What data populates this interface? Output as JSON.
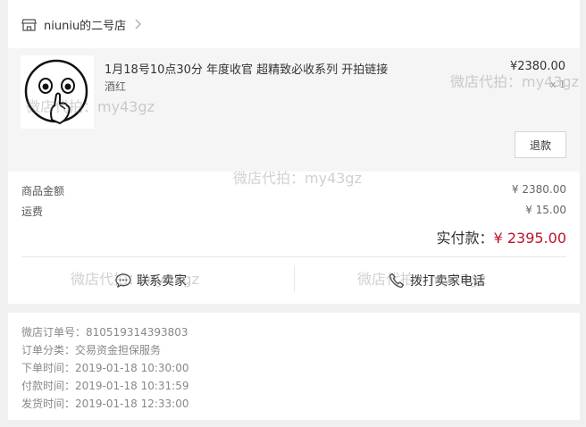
{
  "shop": {
    "name": "niuniu的二号店"
  },
  "product": {
    "title": "1月18号10点30分 年度收官 超精致必收系列 开拍链接",
    "variant": "酒红",
    "price": "¥2380.00",
    "quantity": "x 1",
    "refund_label": "退款"
  },
  "amounts": {
    "goods_label": "商品金额",
    "goods_value": "¥ 2380.00",
    "shipping_label": "运费",
    "shipping_value": "¥ 15.00",
    "total_label": "实付款：",
    "total_value": "¥ 2395.00"
  },
  "actions": {
    "contact_label": "联系卖家",
    "call_label": "拨打卖家电话"
  },
  "order_info": [
    {
      "label": "微店订单号：",
      "value": "810519314393803"
    },
    {
      "label": "订单分类：",
      "value": "交易资金担保服务"
    },
    {
      "label": "下单时间：",
      "value": "2019-01-18 10:30:00"
    },
    {
      "label": "付款时间：",
      "value": "2019-01-18 10:31:59"
    },
    {
      "label": "发货时间：",
      "value": "2019-01-18 12:33:00"
    }
  ],
  "watermark": "微店代拍：my43gz",
  "colors": {
    "accent_red": "#c0122b",
    "page_bg": "#f0f0f0",
    "product_bg": "#f5f5f5"
  },
  "icons": [
    "shop-icon",
    "chevron-right-icon",
    "chat-icon",
    "phone-icon"
  ]
}
